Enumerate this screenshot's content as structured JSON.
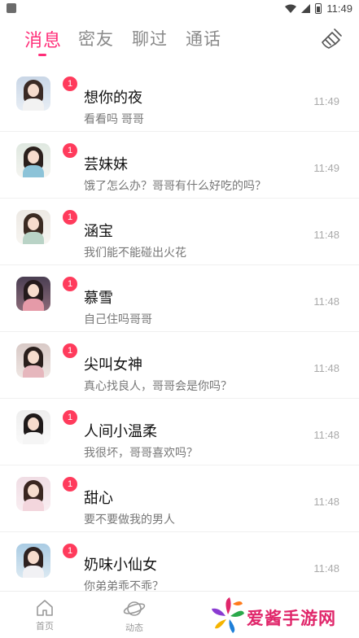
{
  "status_bar": {
    "time": "11:49"
  },
  "tabs": [
    {
      "label": "消息",
      "active": true
    },
    {
      "label": "密友",
      "active": false
    },
    {
      "label": "聊过",
      "active": false
    },
    {
      "label": "通话",
      "active": false
    }
  ],
  "accent_color": "#ff2d78",
  "badge_color": "#ff3b5c",
  "clear_icon": "broom-icon",
  "conversations": [
    {
      "name": "想你的夜",
      "preview": "看看吗 哥哥",
      "time": "11:49",
      "unread": "1"
    },
    {
      "name": "芸妹妹",
      "preview": "饿了怎么办？哥哥有什么好吃的吗？",
      "time": "11:49",
      "unread": "1"
    },
    {
      "name": "涵宝",
      "preview": "我们能不能碰出火花",
      "time": "11:48",
      "unread": "1"
    },
    {
      "name": "慕雪",
      "preview": "自己住吗哥哥",
      "time": "11:48",
      "unread": "1"
    },
    {
      "name": "尖叫女神",
      "preview": "真心找良人，哥哥会是你吗？",
      "time": "11:48",
      "unread": "1"
    },
    {
      "name": "人间小温柔",
      "preview": "我很坏，哥哥喜欢吗？",
      "time": "11:48",
      "unread": "1"
    },
    {
      "name": "甜心",
      "preview": "要不要做我的男人",
      "time": "11:48",
      "unread": "1"
    },
    {
      "name": "奶味小仙女",
      "preview": "你弟弟乖不乖？",
      "time": "11:48",
      "unread": "1"
    }
  ],
  "bottom_nav": [
    {
      "label": "首页",
      "icon": "home-icon"
    },
    {
      "label": "动态",
      "icon": "planet-icon"
    }
  ],
  "watermark": {
    "text": "爱酱手游网"
  }
}
